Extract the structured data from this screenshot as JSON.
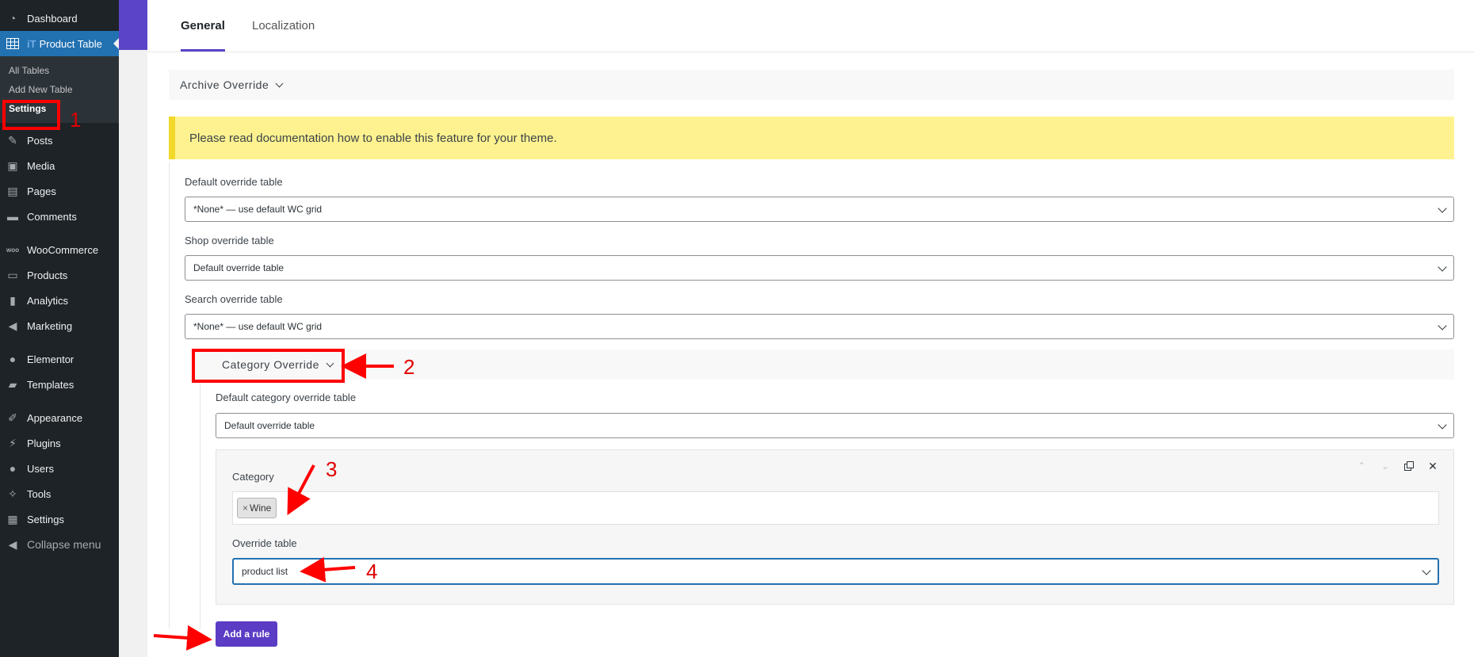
{
  "sidebar": {
    "items_top": [
      {
        "label": "Dashboard",
        "icon": "dashboard-icon"
      }
    ],
    "active": {
      "badge": "iT",
      "label": "Product Table",
      "icon": "table-icon"
    },
    "submenu": [
      {
        "label": "All Tables"
      },
      {
        "label": "Add New Table"
      },
      {
        "label": "Settings"
      }
    ],
    "items": [
      {
        "label": "Posts",
        "icon": "pin-icon"
      },
      {
        "label": "Media",
        "icon": "media-icon"
      },
      {
        "label": "Pages",
        "icon": "pages-icon"
      },
      {
        "label": "Comments",
        "icon": "comments-icon"
      },
      {
        "label": "WooCommerce",
        "icon": "woo-icon"
      },
      {
        "label": "Products",
        "icon": "products-icon"
      },
      {
        "label": "Analytics",
        "icon": "analytics-icon"
      },
      {
        "label": "Marketing",
        "icon": "megaphone-icon"
      },
      {
        "label": "Elementor",
        "icon": "elementor-icon"
      },
      {
        "label": "Templates",
        "icon": "folder-icon"
      },
      {
        "label": "Appearance",
        "icon": "brush-icon"
      },
      {
        "label": "Plugins",
        "icon": "plugin-icon"
      },
      {
        "label": "Users",
        "icon": "user-icon"
      },
      {
        "label": "Tools",
        "icon": "wrench-icon"
      },
      {
        "label": "Settings",
        "icon": "settings-icon"
      },
      {
        "label": "Collapse menu",
        "icon": "collapse-icon"
      }
    ]
  },
  "tabs": [
    {
      "label": "General"
    },
    {
      "label": "Localization"
    }
  ],
  "archive_section": {
    "title": "Archive Override"
  },
  "notice": "Please read documentation how to enable this feature for your theme.",
  "fields": {
    "default_override": {
      "label": "Default override table",
      "value": "*None* — use default WC grid"
    },
    "shop_override": {
      "label": "Shop override table",
      "value": "Default override table"
    },
    "search_override": {
      "label": "Search override table",
      "value": "*None* — use default WC grid"
    }
  },
  "category_section": {
    "title": "Category Override",
    "default_category": {
      "label": "Default category override table",
      "value": "Default override table"
    },
    "rule": {
      "category_label": "Category",
      "tags": [
        {
          "label": "Wine"
        }
      ],
      "tag_remove": "×",
      "override_label": "Override table",
      "override_value": "product list"
    },
    "add_rule": "Add a rule"
  },
  "annotations": {
    "n1": "1",
    "n2": "2",
    "n3": "3",
    "n4": "4",
    "color": "#ff0000"
  },
  "colors": {
    "accent": "#5b3cc4",
    "sidebar_bg": "#1d2327",
    "active_blue": "#2271b1",
    "notice_bg": "#fdf28f"
  }
}
